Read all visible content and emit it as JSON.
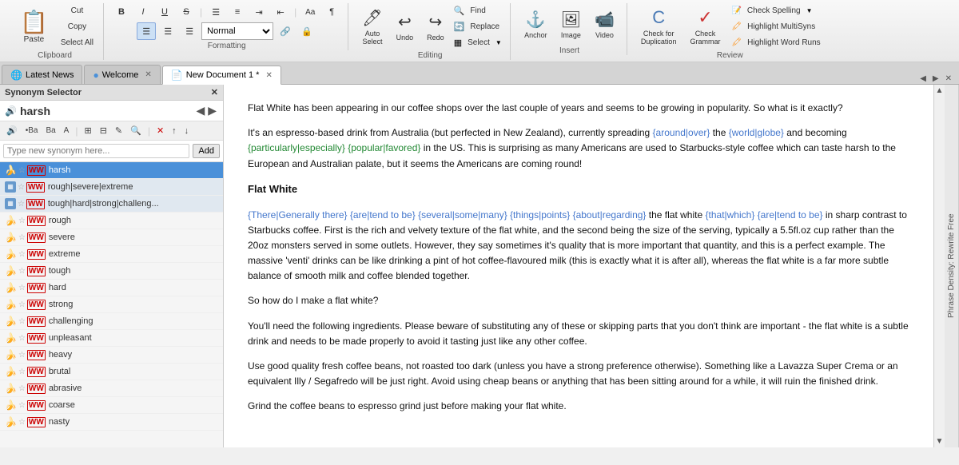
{
  "toolbar": {
    "clipboard_label": "Clipboard",
    "formatting_label": "Formatting",
    "editing_label": "Editing",
    "insert_label": "Insert",
    "review_label": "Review",
    "paste_label": "Paste",
    "cut_label": "Cut",
    "copy_label": "Copy",
    "select_all_label": "Select All",
    "bold_label": "B",
    "italic_label": "I",
    "underline_label": "U",
    "strikethrough_label": "S",
    "bullets_label": "≡",
    "numbered_label": "≡",
    "indent_label": "→",
    "outdent_label": "←",
    "dropdown_value": "Normal",
    "link_label": "🔗",
    "anchor_label": "Anchor",
    "auto_select_label": "Auto\nSelect",
    "undo_label": "Undo",
    "redo_label": "Redo",
    "select_label": "Select",
    "find_label": "Find",
    "replace_label": "Replace",
    "image_label": "Image",
    "video_label": "Video",
    "check_dup_label": "Check for\nDuplication",
    "check_gram_label": "Check\nGrammar",
    "check_spell_label": "Check Spelling",
    "highlight_multi_label": "Highlight MultiSyns",
    "highlight_word_label": "Highlight Word Runs"
  },
  "tabs": {
    "items": [
      {
        "label": "Latest News",
        "icon": "🌐",
        "active": false,
        "closable": false
      },
      {
        "label": "Welcome",
        "icon": "🔵",
        "active": false,
        "closable": true
      },
      {
        "label": "New Document 1 *",
        "icon": "📄",
        "active": true,
        "closable": true
      }
    ]
  },
  "synonym_panel": {
    "title": "Synonym Selector",
    "word": "harsh",
    "search_placeholder": "Type new synonym here...",
    "add_label": "Add",
    "items": [
      {
        "text": "harsh",
        "selected": true,
        "group": false
      },
      {
        "text": "rough|severe|extreme",
        "selected": false,
        "group": true
      },
      {
        "text": "tough|hard|strong|challeng...",
        "selected": false,
        "group": true
      },
      {
        "text": "rough",
        "selected": false,
        "group": false
      },
      {
        "text": "severe",
        "selected": false,
        "group": false
      },
      {
        "text": "extreme",
        "selected": false,
        "group": false
      },
      {
        "text": "tough",
        "selected": false,
        "group": false
      },
      {
        "text": "hard",
        "selected": false,
        "group": false
      },
      {
        "text": "strong",
        "selected": false,
        "group": false
      },
      {
        "text": "challenging",
        "selected": false,
        "group": false
      },
      {
        "text": "unpleasant",
        "selected": false,
        "group": false
      },
      {
        "text": "heavy",
        "selected": false,
        "group": false
      },
      {
        "text": "brutal",
        "selected": false,
        "group": false
      },
      {
        "text": "abrasive",
        "selected": false,
        "group": false
      },
      {
        "text": "coarse",
        "selected": false,
        "group": false
      },
      {
        "text": "nasty",
        "selected": false,
        "group": false
      }
    ]
  },
  "document": {
    "title": "New Document 1",
    "paragraphs": [
      "Flat White has been appearing in our coffee shops over the last couple of years and seems to be growing in popularity. So what is it exactly?",
      "It's an espresso-based drink from Australia (but perfected in New Zealand), currently spreading {around|over} the {world|globe} and becoming {particularly|especially} {popular|favored} in the US. This is surprising as many Americans are used to Starbucks-style coffee which can taste harsh to the European and Australian palate, but it seems the Americans are coming round!",
      "Flat White",
      "{There|Generally there} {are|tend to be} {several|some|many} {things|points} {about|regarding} the flat white {that|which} {are|tend to be} in sharp contrast to Starbucks coffee. First is the rich and velvety texture of the flat white, and the second being the size of the serving, typically a 5.5fl.oz cup rather than the 20oz monsters served in some outlets. However, they say sometimes it's quality that is more important that quantity, and this is a perfect example. The massive 'venti' drinks can be like drinking a pint of hot coffee-flavoured milk (this is exactly what it is after all), whereas the flat white is a far more subtle balance of smooth milk and coffee blended together.",
      "So how do I make a flat white?",
      "You'll need the following ingredients. Please beware of substituting any of these or skipping parts that you don't think are important - the flat white is a subtle drink and needs to be made properly to avoid it tasting just like any other coffee.",
      "Use good quality fresh coffee beans, not roasted too dark (unless you have a strong preference otherwise). Something like a Lavazza Super Crema or an equivalent Illy / Segafredo will be just right. Avoid using cheap beans or anything that has been sitting around for a while, it will ruin the finished drink.",
      "Grind the coffee beans to espresso grind just before making your flat white."
    ],
    "side_panel_label": "Phrase Density: Rewrite Free"
  }
}
